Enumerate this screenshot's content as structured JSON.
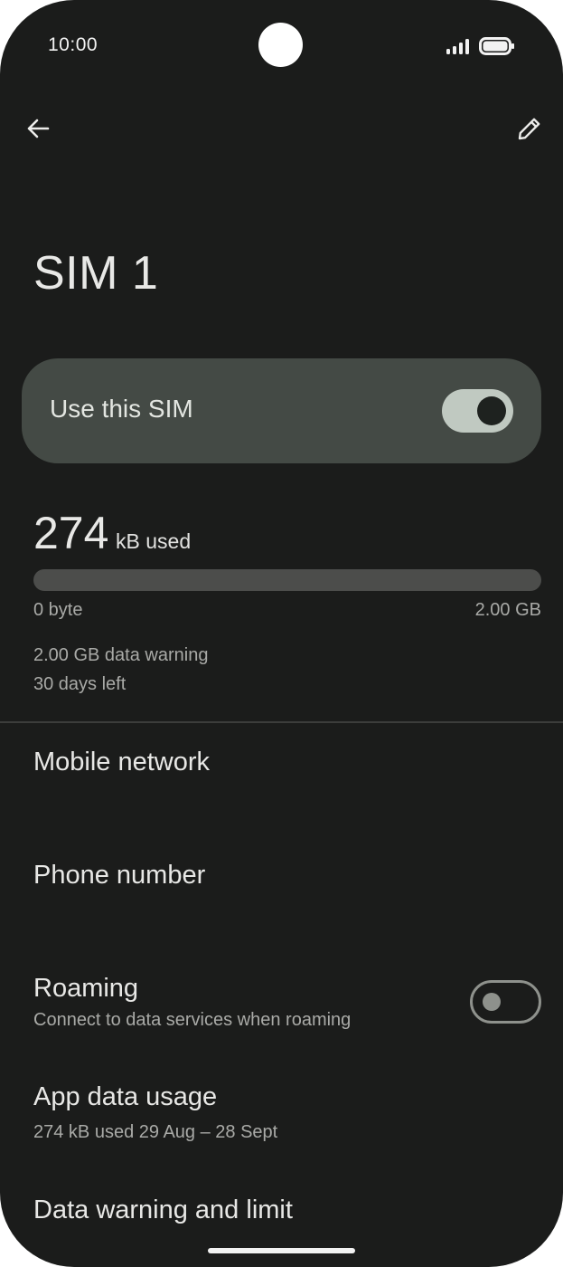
{
  "status_bar": {
    "time": "10:00"
  },
  "toolbar": {
    "back_icon": "arrow-back-icon",
    "edit_icon": "pencil-icon"
  },
  "page": {
    "title": "SIM 1"
  },
  "use_sim": {
    "label": "Use this SIM",
    "enabled": true
  },
  "usage": {
    "amount": "274",
    "unit": "kB used",
    "fraction_of_limit": 0.0,
    "bar_min_label": "0 byte",
    "bar_max_label": "2.00 GB",
    "warning": "2.00 GB data warning",
    "days_left": "30 days left"
  },
  "settings": {
    "mobile_network": {
      "title": "Mobile network"
    },
    "phone_number": {
      "title": "Phone number"
    },
    "roaming": {
      "title": "Roaming",
      "subtitle": "Connect to data services when roaming",
      "enabled": false
    },
    "app_data_usage": {
      "title": "App data usage",
      "subtitle": "274 kB used 29 Aug – 28 Sept"
    },
    "data_warning_limit": {
      "title": "Data warning and limit"
    }
  },
  "colors": {
    "background": "#1b1c1b",
    "card": "#444a45",
    "toggle_on_track": "#c0c9c1",
    "secondary_text": "#a9aaa7"
  }
}
